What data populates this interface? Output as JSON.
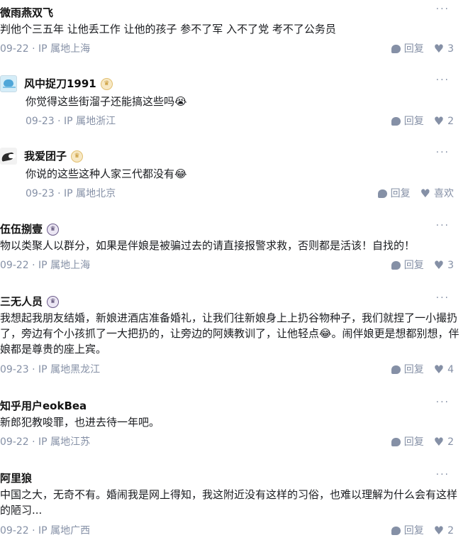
{
  "ui": {
    "more_glyph": "···",
    "reply_label": "回复",
    "dot": "·",
    "heart_glyph": "♥",
    "crown_glyph": "♛"
  },
  "comments": [
    {
      "author": "微雨燕双飞",
      "text": "判他个三五年 让他丢工作 让他的孩子 参不了军 入不了党 考不了公务员",
      "date": "09-22",
      "ip": "IP 属地上海",
      "likes": "3"
    },
    {
      "author": "风中捉刀1991",
      "text": "你觉得这些街溜子还能搞这些吗😭",
      "date": "09-23",
      "ip": "IP 属地浙江",
      "likes": "2"
    },
    {
      "author": "我爱团子",
      "text": "你说的这些这种人家三代都没有😂",
      "date": "09-23",
      "ip": "IP 属地北京",
      "likes": "喜欢"
    },
    {
      "author": "伍伍捌壹",
      "text": "物以类聚人以群分，如果是伴娘是被骗过去的请直接报警求救，否则都是活该！自找的！",
      "date": "09-22",
      "ip": "IP 属地上海",
      "likes": "3"
    },
    {
      "author": "三无人员",
      "text": "我想起我朋友结婚，新娘进酒店准备婚礼，让我们往新娘身上上扔谷物种子，我们就捏了一小撮扔了，旁边有个小孩抓了一大把扔的，让旁边的阿姨教训了，让他轻点😂。闹伴娘更是想都别想，伴娘都是尊贵的座上宾。",
      "date": "09-23",
      "ip": "IP 属地黑龙江",
      "likes": "4"
    },
    {
      "author": "知乎用户eokBea",
      "text": "新郎犯教唆罪，也进去待一年吧。",
      "date": "09-22",
      "ip": "IP 属地江苏",
      "likes": "2"
    },
    {
      "author": "阿里狼",
      "text": "中国之大，无奇不有。婚闹我是网上得知，我这附近没有这样的习俗，也难以理解为什么会有这样的陋习...",
      "date": "09-22",
      "ip": "IP 属地广西",
      "likes": "2"
    }
  ]
}
